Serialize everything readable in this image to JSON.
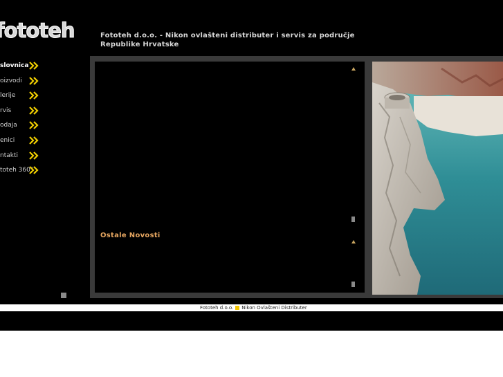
{
  "header": {
    "logo_text": "fototeh",
    "title": "Fototeh d.o.o. - Nikon ovlašteni distributer i servis za područje Republike Hrvatske"
  },
  "nav": {
    "items": [
      {
        "label": "slovnica",
        "active": true
      },
      {
        "label": "oizvodi",
        "active": false
      },
      {
        "label": "lerije",
        "active": false
      },
      {
        "label": "rvis",
        "active": false
      },
      {
        "label": "odaja",
        "active": false
      },
      {
        "label": "enici",
        "active": false
      },
      {
        "label": "ntakti",
        "active": false
      },
      {
        "label": "toteh 360°",
        "active": false
      }
    ]
  },
  "main": {
    "news_heading": "Ostale Novosti"
  },
  "footer": {
    "company": "Fototeh d.o.o.",
    "tagline": "Nikon Ovlašteni Distributer"
  },
  "colors": {
    "background": "#000000",
    "frame": "#3a3a3a",
    "accent_orange": "#e6a660",
    "arrow_yellow": "#f2d000"
  },
  "icons": {
    "nav_arrow": "double-chevron-right-icon",
    "scroll_up": "scroll-up-arrow-icon"
  }
}
